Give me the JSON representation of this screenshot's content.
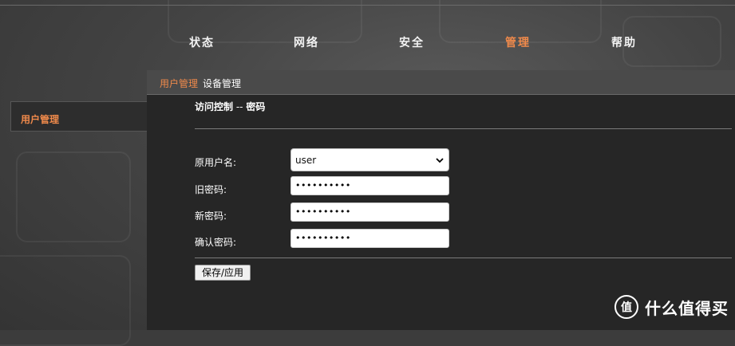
{
  "nav": {
    "items": [
      {
        "label": "状态",
        "active": false
      },
      {
        "label": "网络",
        "active": false
      },
      {
        "label": "安全",
        "active": false
      },
      {
        "label": "管理",
        "active": true
      },
      {
        "label": "帮助",
        "active": false
      }
    ]
  },
  "sidebar": {
    "items": [
      {
        "label": "用户管理",
        "active": true
      }
    ]
  },
  "tabs": [
    {
      "label": "用户管理",
      "active": true
    },
    {
      "label": "设备管理",
      "active": false
    }
  ],
  "section": {
    "title_main": "访问控制",
    "title_sep": " -- ",
    "title_sub": "密码"
  },
  "form": {
    "username_label": "原用户名:",
    "username_value": "user",
    "old_password_label": "旧密码:",
    "old_password_mask": "••••••••••",
    "new_password_label": "新密码:",
    "new_password_mask": "••••••••••",
    "confirm_password_label": "确认密码:",
    "confirm_password_mask": "••••••••••",
    "submit_label": "保存/应用"
  },
  "watermark": {
    "logo_glyph": "值",
    "text": "什么值得买"
  },
  "colors": {
    "accent": "#f08a4b",
    "panel": "#262626",
    "tabbar": "#4a4a4a"
  }
}
